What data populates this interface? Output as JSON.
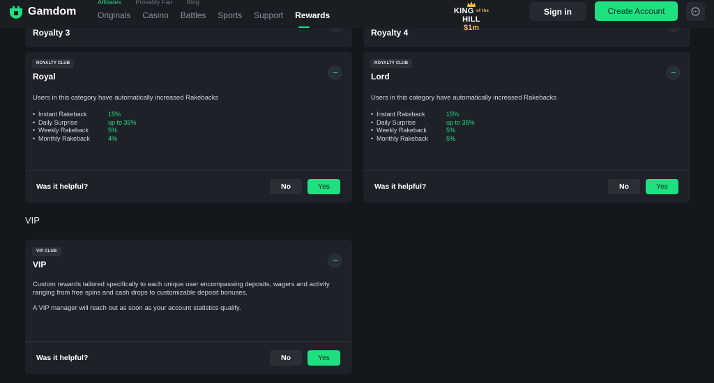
{
  "header": {
    "brand": "Gamdom",
    "subnav": [
      "Affiliates",
      "Provably Fair",
      "Blog"
    ],
    "nav": [
      "Originals",
      "Casino",
      "Battles",
      "Sports",
      "Support",
      "Rewards"
    ],
    "active_nav": "Rewards",
    "promo": {
      "line1": "KING",
      "connector": "of the",
      "line2": "HILL",
      "amount": "$1m"
    },
    "signin_label": "Sign in",
    "create_label": "Create Account",
    "chat_icon": "chat-bubble-icon",
    "accent": "#1fe081"
  },
  "peek_cards": [
    {
      "title": "Royalty 3"
    },
    {
      "title": "Royalty 4"
    }
  ],
  "cards": [
    {
      "badge": "ROYALTY CLUB",
      "title": "Royal",
      "description": "Users in this category have automatically increased Rakebacks",
      "perks": [
        {
          "label": "Instant Rakeback",
          "value": "15%"
        },
        {
          "label": "Daily Surprise",
          "value": "up to 35%"
        },
        {
          "label": "Weekly Rakeback",
          "value": "5%"
        },
        {
          "label": "Monthly Rakeback",
          "value": "4%"
        }
      ],
      "helpful": "Was it helpful?",
      "no": "No",
      "yes": "Yes"
    },
    {
      "badge": "ROYALTY CLUB",
      "title": "Lord",
      "description": "Users in this category have automatically increased Rakebacks",
      "perks": [
        {
          "label": "Instant Rakeback",
          "value": "15%"
        },
        {
          "label": "Daily Surprise",
          "value": "up to 35%"
        },
        {
          "label": "Weekly Rakeback",
          "value": "5%"
        },
        {
          "label": "Monthly Rakeback",
          "value": "5%"
        }
      ],
      "helpful": "Was it helpful?",
      "no": "No",
      "yes": "Yes"
    }
  ],
  "vip_section": {
    "heading": "VIP",
    "card": {
      "badge": "VIP CLUB",
      "title": "VIP",
      "paragraphs": [
        "Custom rewards tailored specifically to each unique user encompassing deposits, wagers and activity ranging from free spins and cash drops to customizable deposit bonuses.",
        "A VIP manager will reach out as soon as your account statistics qualify."
      ],
      "helpful": "Was it helpful?",
      "no": "No",
      "yes": "Yes"
    }
  }
}
